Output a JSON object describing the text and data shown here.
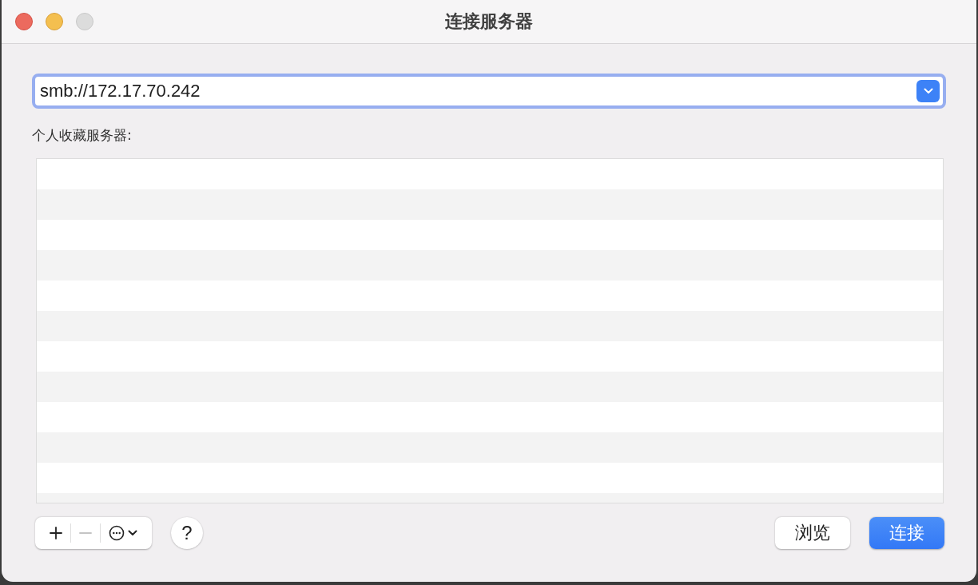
{
  "window": {
    "title": "连接服务器",
    "controls": [
      {
        "kind": "close",
        "disabled": false
      },
      {
        "kind": "minimize",
        "disabled": false
      },
      {
        "kind": "zoom",
        "disabled": true
      }
    ]
  },
  "address": {
    "value": "smb://172.17.70.242",
    "focused": true
  },
  "favorites_label": "个人收藏服务器:",
  "list_tools": [
    {
      "kind": "add",
      "disabled": false
    },
    {
      "kind": "remove",
      "disabled": true
    },
    {
      "kind": "action",
      "disabled": false
    }
  ],
  "help": "?",
  "buttons": [
    {
      "label": "浏览",
      "default": false
    },
    {
      "label": "连接",
      "default": true
    }
  ]
}
